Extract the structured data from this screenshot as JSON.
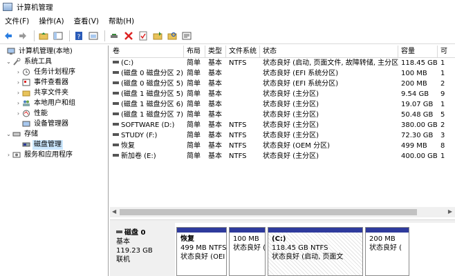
{
  "window": {
    "title": "计算机管理"
  },
  "menu": [
    "文件(F)",
    "操作(A)",
    "查看(V)",
    "帮助(H)"
  ],
  "toolbar_icons": [
    "back-arrow-icon",
    "forward-arrow-icon",
    "up-folder-icon",
    "show-tree-icon",
    "help-icon",
    "console-icon",
    "connect-icon",
    "delete-icon",
    "check-icon",
    "open-folder-icon",
    "search-folder-icon",
    "properties-icon"
  ],
  "tree": {
    "root": "计算机管理(本地)",
    "system_tools": "系统工具",
    "task_scheduler": "任务计划程序",
    "event_viewer": "事件查看器",
    "shared_folders": "共享文件夹",
    "local_users": "本地用户和组",
    "performance": "性能",
    "device_manager": "设备管理器",
    "storage": "存储",
    "disk_management": "磁盘管理",
    "services_apps": "服务和应用程序"
  },
  "volumes": {
    "columns": [
      "卷",
      "布局",
      "类型",
      "文件系统",
      "状态",
      "容量",
      "可"
    ],
    "rows": [
      [
        "(C:)",
        "简单",
        "基本",
        "NTFS",
        "状态良好 (启动, 页面文件, 故障转储, 主分区)",
        "118.45 GB",
        "1"
      ],
      [
        "(磁盘 0 磁盘分区 2)",
        "简单",
        "基本",
        "",
        "状态良好 (EFI 系统分区)",
        "100 MB",
        "1"
      ],
      [
        "(磁盘 0 磁盘分区 5)",
        "简单",
        "基本",
        "",
        "状态良好 (EFI 系统分区)",
        "200 MB",
        "2"
      ],
      [
        "(磁盘 1 磁盘分区 5)",
        "简单",
        "基本",
        "",
        "状态良好 (主分区)",
        "9.54 GB",
        "9"
      ],
      [
        "(磁盘 1 磁盘分区 6)",
        "简单",
        "基本",
        "",
        "状态良好 (主分区)",
        "19.07 GB",
        "1"
      ],
      [
        "(磁盘 1 磁盘分区 7)",
        "简单",
        "基本",
        "",
        "状态良好 (主分区)",
        "50.48 GB",
        "5"
      ],
      [
        "SOFTWARE (D:)",
        "简单",
        "基本",
        "NTFS",
        "状态良好 (主分区)",
        "380.00 GB",
        "2"
      ],
      [
        "STUDY (F:)",
        "简单",
        "基本",
        "NTFS",
        "状态良好 (主分区)",
        "72.30 GB",
        "3"
      ],
      [
        "恢复",
        "简单",
        "基本",
        "NTFS",
        "状态良好 (OEM 分区)",
        "499 MB",
        "8"
      ],
      [
        "新加卷 (E:)",
        "简单",
        "基本",
        "NTFS",
        "状态良好 (主分区)",
        "400.00 GB",
        "1"
      ]
    ]
  },
  "disk0": {
    "name": "磁盘 0",
    "type": "基本",
    "size": "119.23 GB",
    "status": "联机",
    "partitions": [
      {
        "name": "恢复",
        "size": "499 MB NTFS",
        "status": "状态良好 (OEI"
      },
      {
        "name": "",
        "size": "100 MB",
        "status": "状态良好 ("
      },
      {
        "name": "(C:)",
        "size": "118.45 GB NTFS",
        "status": "状态良好 (启动, 页面文"
      },
      {
        "name": "",
        "size": "200 MB",
        "status": "状态良好 ("
      }
    ]
  },
  "colors": {
    "partition_band": "#2e3a9c",
    "selection": "#cce8ff"
  }
}
